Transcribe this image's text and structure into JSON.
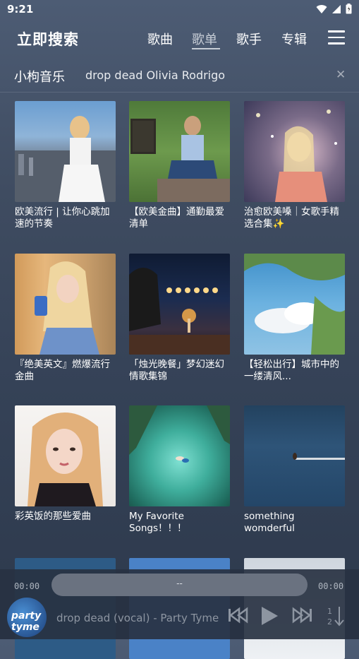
{
  "status": {
    "time": "9:21"
  },
  "header": {
    "title": "立即搜索",
    "tabs": [
      {
        "label": "歌曲"
      },
      {
        "label": "歌单"
      },
      {
        "label": "歌手"
      },
      {
        "label": "专辑"
      }
    ]
  },
  "search": {
    "source": "小枸音乐",
    "query": "drop dead Olivia Rodrigo"
  },
  "playlists": [
    {
      "title": "欧美流行 | 让你心跳加速的节奏"
    },
    {
      "title": "【欧美金曲】通勤最爱清单"
    },
    {
      "title": "治愈欧美嗓｜女歌手精选合集✨"
    },
    {
      "title": "『绝美英文』燃爆流行金曲"
    },
    {
      "title": "「烛光晚餐」梦幻迷幻情歌集锦"
    },
    {
      "title": "【轻松出行】城市中的一缕清风..."
    },
    {
      "title": "彩英饭的那些爱曲"
    },
    {
      "title": "My Favorite Songs！！！"
    },
    {
      "title": "something womderful"
    }
  ],
  "player": {
    "elapsed": "00:00",
    "duration": "00:00",
    "progress_label": "--",
    "cover_text": "party tyme",
    "song": "drop dead (vocal) - Party Tyme"
  }
}
